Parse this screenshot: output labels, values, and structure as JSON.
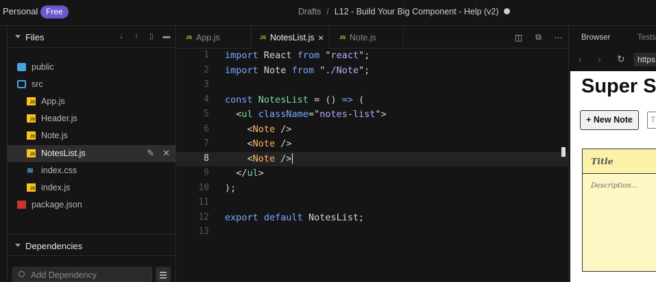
{
  "topbar": {
    "workspace": "Personal",
    "plan_badge": "Free",
    "breadcrumb_folder": "Drafts",
    "breadcrumb_separator": "/",
    "sandbox_title": "L12 - Build Your Big Component - Help (v2)"
  },
  "sidebar": {
    "files_header": "Files",
    "tree": [
      {
        "name": "public",
        "type": "folder"
      },
      {
        "name": "src",
        "type": "folder-open"
      },
      {
        "name": "App.js",
        "type": "js"
      },
      {
        "name": "Header.js",
        "type": "js"
      },
      {
        "name": "Note.js",
        "type": "js"
      },
      {
        "name": "NotesList.js",
        "type": "js",
        "active": true
      },
      {
        "name": "index.css",
        "type": "css"
      },
      {
        "name": "index.js",
        "type": "js"
      },
      {
        "name": "package.json",
        "type": "npm"
      }
    ],
    "dependencies_header": "Dependencies",
    "dependency_search_placeholder": "Add Dependency"
  },
  "editor": {
    "tabs": [
      {
        "label": "App.js",
        "badge": "JS"
      },
      {
        "label": "NotesList.js",
        "badge": "JS",
        "active": true
      },
      {
        "label": "Note.js",
        "badge": "JS"
      }
    ],
    "current_line": 8,
    "line_numbers": [
      "1",
      "2",
      "3",
      "4",
      "5",
      "6",
      "7",
      "8",
      "9",
      "10",
      "11",
      "12",
      "13"
    ]
  },
  "preview": {
    "tabs": [
      "Browser",
      "Tests"
    ],
    "url": "https",
    "app_title": "Super St",
    "new_note_button": "+ New Note",
    "search_placeholder": "T",
    "note_title": "Title",
    "note_description": "Description..."
  },
  "colors": {
    "accent": "#6e56cf",
    "folder": "#4aa3df",
    "js_badge": "#f5c518",
    "keyword": "#79a8ff",
    "string": "#c3e88d",
    "jsx_tag": "#ffb85c",
    "note_bg": "#fdf7c3"
  }
}
